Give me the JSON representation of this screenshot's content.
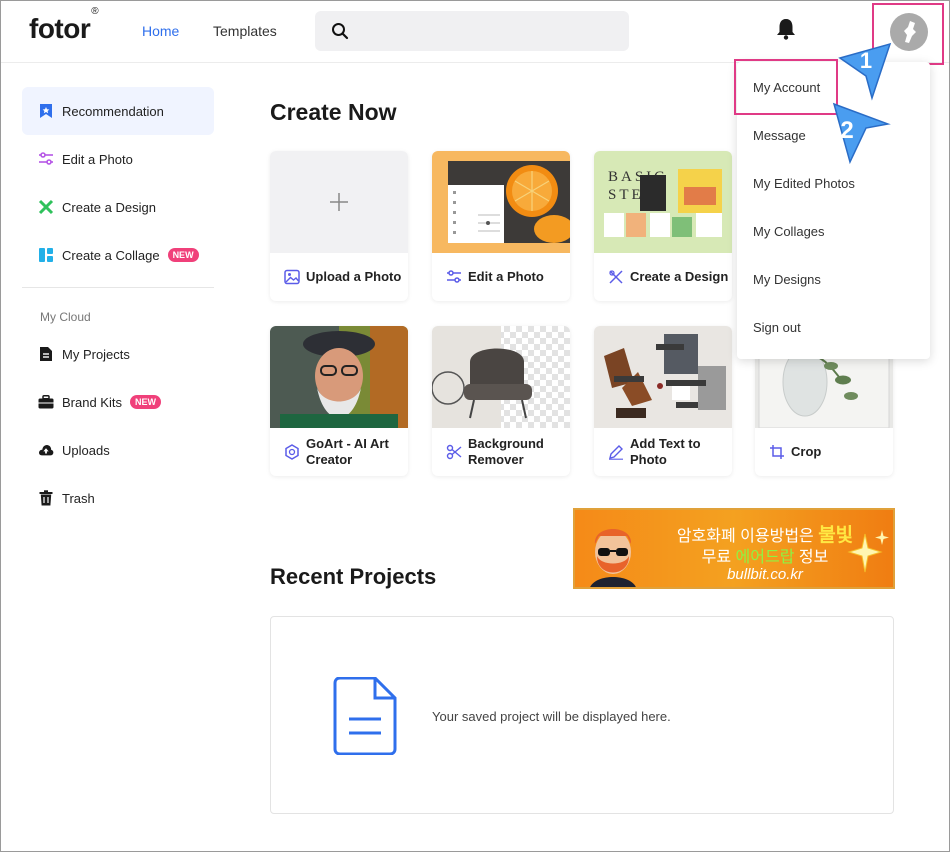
{
  "header": {
    "logo": "fotor",
    "logo_reg": "®",
    "nav_home": "Home",
    "nav_templates": "Templates",
    "search_placeholder": ""
  },
  "sidebar": {
    "items": [
      {
        "label": "Recommendation",
        "icon": "star-bookmark-icon",
        "active": true
      },
      {
        "label": "Edit a Photo",
        "icon": "sliders-icon"
      },
      {
        "label": "Create a Design",
        "icon": "design-icon"
      },
      {
        "label": "Create a Collage",
        "icon": "collage-icon",
        "badge": "NEW"
      }
    ],
    "cloud_title": "My Cloud",
    "cloud_items": [
      {
        "label": "My Projects",
        "icon": "document-icon"
      },
      {
        "label": "Brand Kits",
        "icon": "briefcase-icon",
        "badge": "NEW"
      },
      {
        "label": "Uploads",
        "icon": "cloud-upload-icon"
      },
      {
        "label": "Trash",
        "icon": "trash-icon"
      }
    ]
  },
  "main": {
    "create_title": "Create Now",
    "cards": [
      {
        "label": "Upload a Photo",
        "icon": "image-icon"
      },
      {
        "label": "Edit a Photo",
        "icon": "sliders-icon"
      },
      {
        "label": "Create a Design",
        "icon": "design-icon"
      },
      {
        "label": "GoArt - AI Art Creator",
        "label1": "GoArt - AI Art",
        "label2": "Creator",
        "icon": "goart-icon"
      },
      {
        "label": "Background Remover",
        "label1": "Background",
        "label2": "Remover",
        "icon": "scissors-icon"
      },
      {
        "label": "Add Text to Photo",
        "label1": "Add Text to",
        "label2": "Photo",
        "icon": "pen-icon"
      },
      {
        "label": "Crop",
        "icon": "crop-icon"
      }
    ],
    "design_thumb_text": [
      "BASIC",
      "STEPS"
    ],
    "recent_title": "Recent Projects",
    "empty_text": "Your saved project will be displayed here."
  },
  "dropdown": {
    "items": [
      "My Account",
      "Message",
      "My Edited Photos",
      "My Collages",
      "My Designs",
      "Sign out"
    ]
  },
  "annotations": {
    "step1": "1",
    "step2": "2"
  },
  "ad": {
    "line1_a": "암호화폐 이용방법은 ",
    "line1_b": "불빛",
    "line2_a": "무료 ",
    "line2_b": "에어드랍",
    "line2_c": " 정보",
    "line3": "bullbit.co.kr"
  },
  "colors": {
    "accent": "#2f6fec",
    "badge": "#f0407a",
    "highlight": "#e03a86",
    "pointer": "#3a8fe8"
  }
}
